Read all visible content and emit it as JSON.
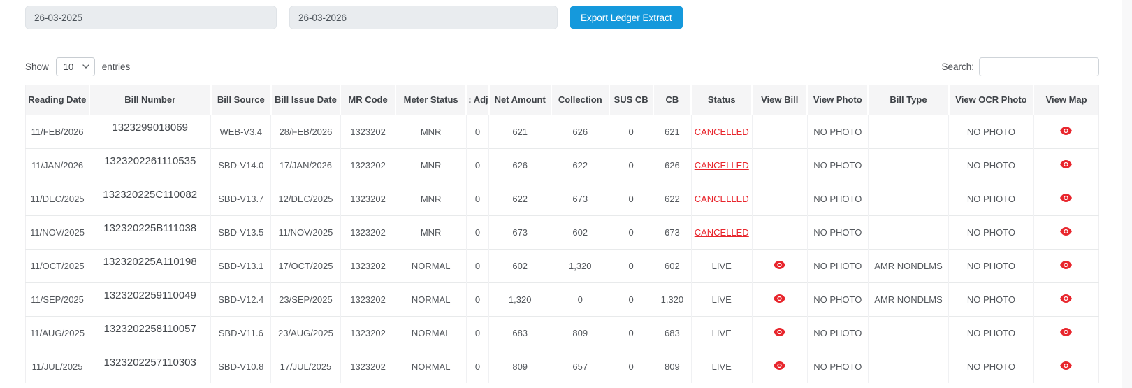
{
  "colors": {
    "accent_blue": "#1599dc",
    "status_red": "#e8262d"
  },
  "filters": {
    "from_date": "26-03-2025",
    "to_date": "26-03-2026",
    "export_button": "Export Ledger Extract"
  },
  "table_controls": {
    "show_label": "Show",
    "page_size": "10",
    "entries_label": "entries",
    "search_label": "Search:",
    "search_value": ""
  },
  "ledger_table": {
    "columns": [
      "Reading Date",
      "Bill Number",
      "Bill Source",
      "Bill Issue Date",
      "MR Code",
      "Meter Status",
      ": Adj",
      "Net Amount",
      "Collection",
      "SUS CB",
      "CB",
      "Status",
      "View Bill",
      "View Photo",
      "Bill Type",
      "View OCR Photo",
      "View Map"
    ],
    "rows": [
      {
        "reading_date": "11/FEB/2026",
        "bill_number": "1323299018069",
        "bill_source": "WEB-V3.4",
        "bill_issue_date": "28/FEB/2026",
        "mr_code": "1323202",
        "meter_status": "MNR",
        "adj": "0",
        "net_amount": "621",
        "collection": "626",
        "sus_cb": "0",
        "cb": "621",
        "status": "CANCELLED",
        "view_bill": "",
        "view_photo": "NO PHOTO",
        "bill_type": "",
        "view_ocr_photo": "NO PHOTO",
        "view_map": "eye-icon"
      },
      {
        "reading_date": "11/JAN/2026",
        "bill_number": "1323202261110535",
        "bill_source": "SBD-V14.0",
        "bill_issue_date": "17/JAN/2026",
        "mr_code": "1323202",
        "meter_status": "MNR",
        "adj": "0",
        "net_amount": "626",
        "collection": "622",
        "sus_cb": "0",
        "cb": "626",
        "status": "CANCELLED",
        "view_bill": "",
        "view_photo": "NO PHOTO",
        "bill_type": "",
        "view_ocr_photo": "NO PHOTO",
        "view_map": "eye-icon"
      },
      {
        "reading_date": "11/DEC/2025",
        "bill_number": "132320225C110082",
        "bill_source": "SBD-V13.7",
        "bill_issue_date": "12/DEC/2025",
        "mr_code": "1323202",
        "meter_status": "MNR",
        "adj": "0",
        "net_amount": "622",
        "collection": "673",
        "sus_cb": "0",
        "cb": "622",
        "status": "CANCELLED",
        "view_bill": "",
        "view_photo": "NO PHOTO",
        "bill_type": "",
        "view_ocr_photo": "NO PHOTO",
        "view_map": "eye-icon"
      },
      {
        "reading_date": "11/NOV/2025",
        "bill_number": "132320225B111038",
        "bill_source": "SBD-V13.5",
        "bill_issue_date": "11/NOV/2025",
        "mr_code": "1323202",
        "meter_status": "MNR",
        "adj": "0",
        "net_amount": "673",
        "collection": "602",
        "sus_cb": "0",
        "cb": "673",
        "status": "CANCELLED",
        "view_bill": "",
        "view_photo": "NO PHOTO",
        "bill_type": "",
        "view_ocr_photo": "NO PHOTO",
        "view_map": "eye-icon"
      },
      {
        "reading_date": "11/OCT/2025",
        "bill_number": "132320225A110198",
        "bill_source": "SBD-V13.1",
        "bill_issue_date": "17/OCT/2025",
        "mr_code": "1323202",
        "meter_status": "NORMAL",
        "adj": "0",
        "net_amount": "602",
        "collection": "1,320",
        "sus_cb": "0",
        "cb": "602",
        "status": "LIVE",
        "view_bill": "eye-icon",
        "view_photo": "NO PHOTO",
        "bill_type": "AMR NONDLMS",
        "view_ocr_photo": "NO PHOTO",
        "view_map": "eye-icon"
      },
      {
        "reading_date": "11/SEP/2025",
        "bill_number": "1323202259110049",
        "bill_source": "SBD-V12.4",
        "bill_issue_date": "23/SEP/2025",
        "mr_code": "1323202",
        "meter_status": "NORMAL",
        "adj": "0",
        "net_amount": "1,320",
        "collection": "0",
        "sus_cb": "0",
        "cb": "1,320",
        "status": "LIVE",
        "view_bill": "eye-icon",
        "view_photo": "NO PHOTO",
        "bill_type": "AMR NONDLMS",
        "view_ocr_photo": "NO PHOTO",
        "view_map": "eye-icon"
      },
      {
        "reading_date": "11/AUG/2025",
        "bill_number": "1323202258110057",
        "bill_source": "SBD-V11.6",
        "bill_issue_date": "23/AUG/2025",
        "mr_code": "1323202",
        "meter_status": "NORMAL",
        "adj": "0",
        "net_amount": "683",
        "collection": "809",
        "sus_cb": "0",
        "cb": "683",
        "status": "LIVE",
        "view_bill": "eye-icon",
        "view_photo": "NO PHOTO",
        "bill_type": "",
        "view_ocr_photo": "NO PHOTO",
        "view_map": "eye-icon"
      },
      {
        "reading_date": "11/JUL/2025",
        "bill_number": "1323202257110303",
        "bill_source": "SBD-V10.8",
        "bill_issue_date": "17/JUL/2025",
        "mr_code": "1323202",
        "meter_status": "NORMAL",
        "adj": "0",
        "net_amount": "809",
        "collection": "657",
        "sus_cb": "0",
        "cb": "809",
        "status": "LIVE",
        "view_bill": "eye-icon",
        "view_photo": "NO PHOTO",
        "bill_type": "",
        "view_ocr_photo": "NO PHOTO",
        "view_map": "eye-icon"
      }
    ]
  }
}
